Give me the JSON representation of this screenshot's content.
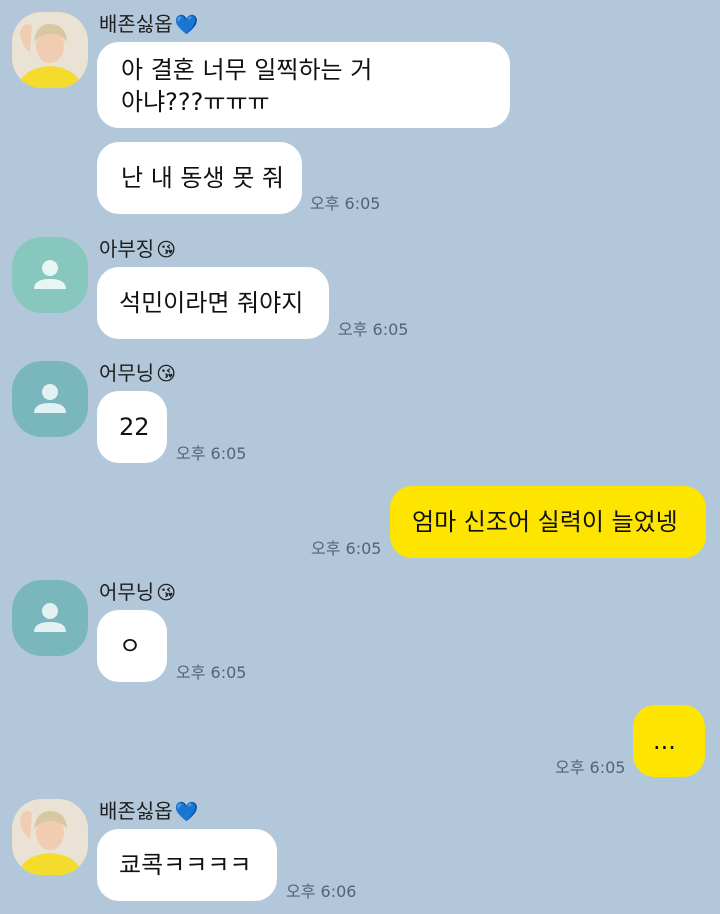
{
  "messages": [
    {
      "sender": "배존싫옵",
      "sender_emoji": "💙",
      "text": "아 결혼 너무 일찍하는 거\n아냐???ㅠㅠㅠ",
      "time": ""
    },
    {
      "text": "난 내 동생 못 줘",
      "time": "오후 6:05"
    },
    {
      "sender": "아부징",
      "sender_emoji": "😘",
      "text": "석민이라면 줘야지",
      "time": "오후 6:05"
    },
    {
      "sender": "어무닝",
      "sender_emoji": "😘",
      "text": "22",
      "time": "오후 6:05"
    },
    {
      "text": "엄마 신조어 실력이 늘었넹",
      "time": "오후 6:05",
      "mine": true
    },
    {
      "sender": "어무닝",
      "sender_emoji": "😘",
      "text": "ㅇ",
      "time": "오후 6:05"
    },
    {
      "text": "...",
      "time": "오후 6:05",
      "mine": true
    },
    {
      "sender": "배존싫옵",
      "sender_emoji": "💙",
      "text": "쿄콕ㅋㅋㅋㅋ",
      "time": "오후 6:06"
    }
  ],
  "colors": {
    "background": "#b2c7d9",
    "my_bubble": "#fee500",
    "other_bubble": "#ffffff"
  }
}
